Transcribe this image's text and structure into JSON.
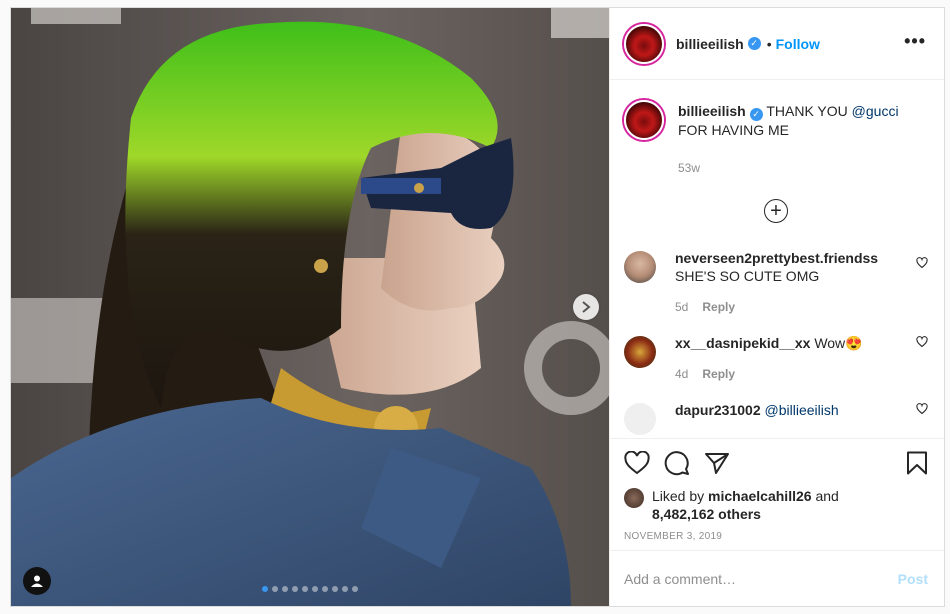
{
  "photo": {
    "carousel_total": 10,
    "carousel_active": 0,
    "next_icon": "chevron-right-icon",
    "tag_icon": "user-tag-icon"
  },
  "header": {
    "username": "billieeilish",
    "verified_icon": "verified-badge-icon",
    "separator": "•",
    "follow_label": "Follow",
    "more_icon": "more-options-icon",
    "more_label": "•••"
  },
  "caption": {
    "username": "billieeilish",
    "text_before": "THANK YOU ",
    "mention": "@gucci",
    "text_after": "FOR HAVING ME",
    "time": "53w"
  },
  "load_more_icon": "plus-circle-icon",
  "comments": [
    {
      "username": "neverseen2prettybest.friendss",
      "text": "SHE'S SO CUTE OMG",
      "time": "5d",
      "reply_label": "Reply"
    },
    {
      "username": "xx__dasnipekid__xx",
      "text": "Wow😍",
      "time": "4d",
      "reply_label": "Reply"
    },
    {
      "username": "dapur231002",
      "mention": "@billieeilish",
      "time": "",
      "reply_label": ""
    }
  ],
  "actions": {
    "like_icon": "heart-icon",
    "comment_icon": "comment-icon",
    "share_icon": "share-icon",
    "save_icon": "bookmark-icon"
  },
  "likes": {
    "prefix": "Liked by ",
    "user": "michaelcahill26",
    "and": " and",
    "count": "8,482,162 others"
  },
  "date": "NOVEMBER 3, 2019",
  "add_comment": {
    "placeholder": "Add a comment…",
    "post_label": "Post"
  },
  "colors": {
    "link": "#00376b",
    "follow": "#0095f6",
    "post_disabled": "#b2dffc",
    "muted": "#8e8e8e"
  }
}
